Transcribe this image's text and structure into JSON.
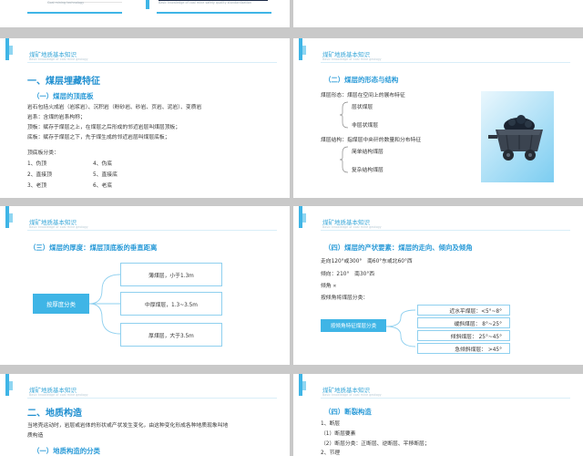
{
  "slide0": {
    "left_subtitle": "Coal mining technology",
    "right_subtitle": "Basic knowledge of coal mine safety quality standardization"
  },
  "header": {
    "title": "煤矿地质基本知识",
    "subtitle": "Basic knowledge of coal mine geology"
  },
  "slide1": {
    "heading": "一、煤层埋藏特征",
    "subheading": "（一）煤层的顶底板",
    "lines": [
      "岩石包括火成岩（岩浆岩）、沉积岩（粉砂岩、砂岩、页岩、泥岩）、变质岩",
      "岩系：含煤的岩系构称；",
      "顶板：赋存于煤层之上，在煤层之后形成的邻近岩层叫煤层顶板；",
      "底板：赋存于煤层之下，先于煤生成的邻近岩层叫煤层底板；"
    ],
    "list_title": "顶底板分类：",
    "list_left": [
      "1、伪顶",
      "2、直接顶",
      "3、老顶"
    ],
    "list_right": [
      "4、伪底",
      "5、直接底",
      "6、老底"
    ]
  },
  "slide2": {
    "heading": "（二）煤层的形态与结构",
    "form_label": "煤层形态：煤层在空间上的展布特征",
    "form_items": [
      "层状煤层",
      "非层状煤层"
    ],
    "struct_label": "煤层结构：指煤层中夹矸的数量和分布特征",
    "struct_items": [
      "简单结构煤层",
      "复杂结构煤层"
    ]
  },
  "slide3": {
    "heading": "（三）煤层的厚度：煤层顶底板的垂直距离",
    "classify": "按厚度分类",
    "items": [
      "薄煤层，小于1.3m",
      "中厚煤层，1.3~3.5m",
      "厚煤层，大于3.5m"
    ]
  },
  "slide4": {
    "heading": "（四）煤层的产状要素：煤层的走向、倾向及倾角",
    "lines": [
      "走向120°或300°　南60°东或北60°西",
      "倾向：210°　南30°西",
      "倾角 ∝",
      "按倾角将煤层分类："
    ],
    "classify": "按倾角特征煤层分类",
    "items": [
      "近水平煤层：<5°~8°",
      "缓斜煤层：  8°~25°",
      "倾斜煤层：  25°~45°",
      "急倾斜煤层：  >45°"
    ]
  },
  "slide5": {
    "heading": "二、地质构造",
    "lines": [
      "当地壳运动时，岩层或岩体的形状或产状发生变化，由这种变化形成各种地质现象叫地",
      "质构造"
    ],
    "subheading": "（一）地质构造的分类"
  },
  "slide6": {
    "heading": "（四）断裂构造",
    "lines": [
      "1、断层",
      "（1）断层要素",
      "（2）断层分类：正断层、逆断层、平移断层；",
      "2、节理"
    ]
  }
}
